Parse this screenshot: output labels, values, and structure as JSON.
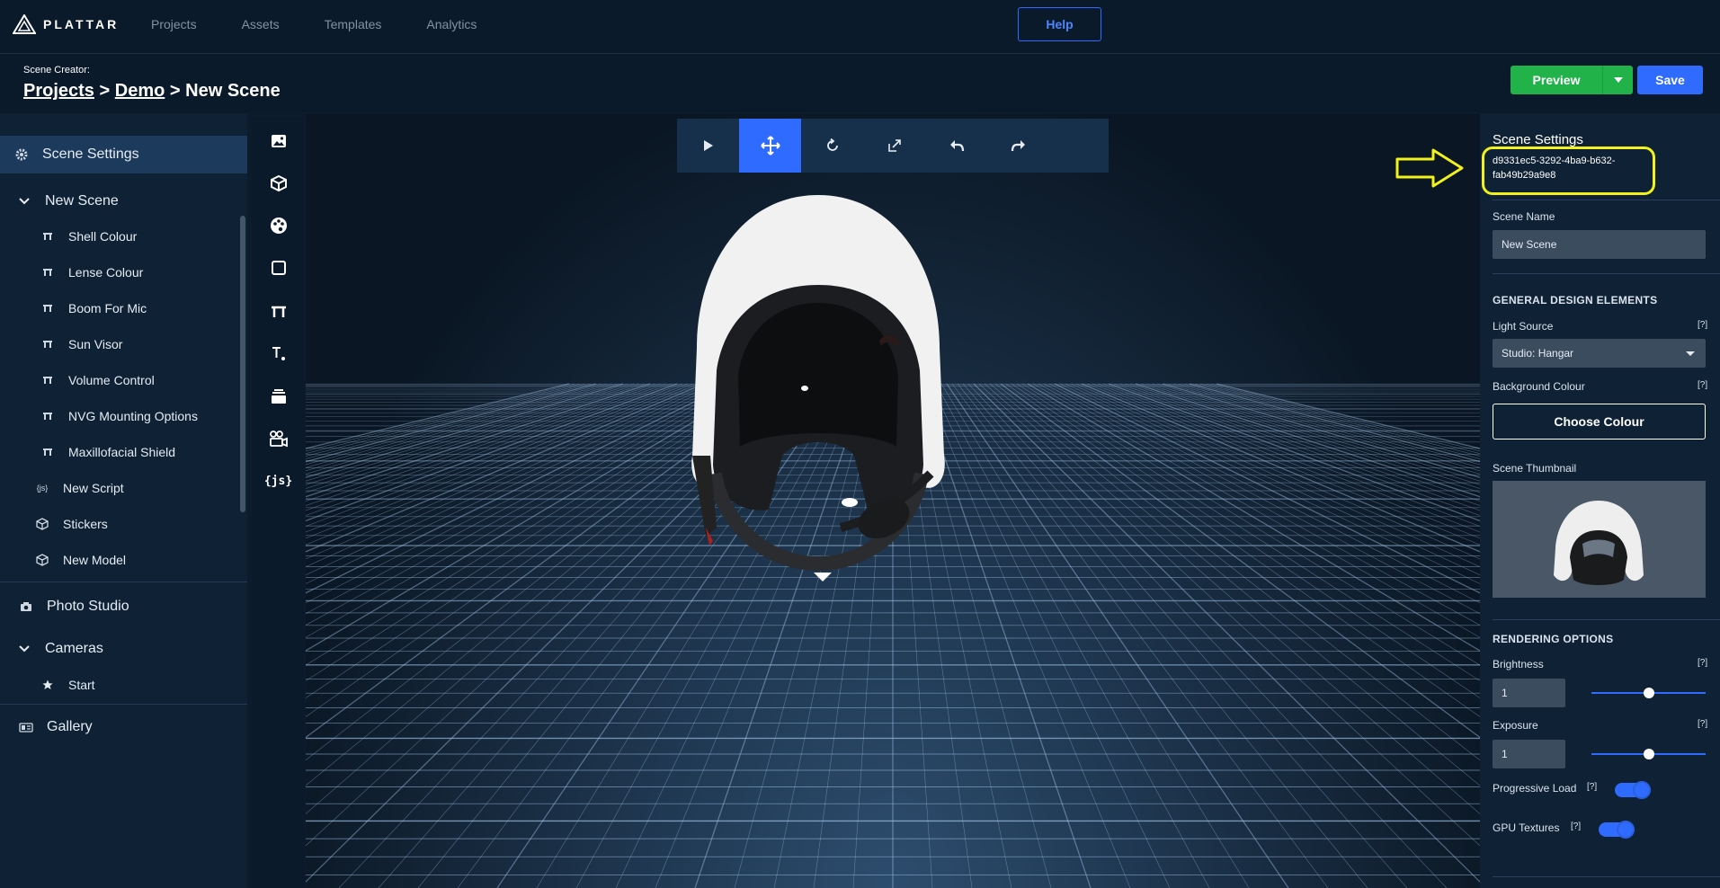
{
  "brand": {
    "name": "PLATTAR"
  },
  "nav": {
    "items": [
      "Projects",
      "Assets",
      "Templates",
      "Analytics"
    ],
    "help": "Help"
  },
  "header": {
    "label": "Scene Creator:",
    "crumb_projects": "Projects",
    "crumb_demo": "Demo",
    "crumb_current": "New Scene",
    "sep": ">",
    "preview": "Preview",
    "save": "Save"
  },
  "sidebar": {
    "scene_settings": "Scene Settings",
    "new_scene": "New Scene",
    "children": [
      "Shell Colour",
      "Lense Colour",
      "Boom For Mic",
      "Sun Visor",
      "Volume Control",
      "NVG Mounting Options",
      "Maxillofacial Shield"
    ],
    "new_script": "New Script",
    "stickers": "Stickers",
    "new_model": "New Model",
    "photo_studio": "Photo Studio",
    "cameras": "Cameras",
    "start": "Start",
    "gallery": "Gallery",
    "js_icon": "{js}"
  },
  "right_panel": {
    "title": "Scene Settings",
    "scene_id": "d9331ec5-3292-4ba9-b632-fab49b29a9e8",
    "scene_name_label": "Scene Name",
    "scene_name_value": "New Scene",
    "general_heading": "GENERAL DESIGN ELEMENTS",
    "light_source_label": "Light Source",
    "light_source_value": "Studio: Hangar",
    "background_label": "Background Colour",
    "choose_colour": "Choose Colour",
    "thumbnail_label": "Scene Thumbnail",
    "rendering_heading": "RENDERING OPTIONS",
    "brightness_label": "Brightness",
    "brightness_value": "1",
    "exposure_label": "Exposure",
    "exposure_value": "1",
    "progressive_label": "Progressive Load",
    "gpu_label": "GPU Textures",
    "help_mark": "[?]"
  },
  "sliders": {
    "brightness_fraction": 0.5,
    "exposure_fraction": 0.5
  },
  "toggles": {
    "progressive_load": true,
    "gpu_textures": true
  },
  "colors": {
    "accent": "#2f6bff",
    "preview": "#21b24a",
    "annotation": "#f2f21a"
  }
}
